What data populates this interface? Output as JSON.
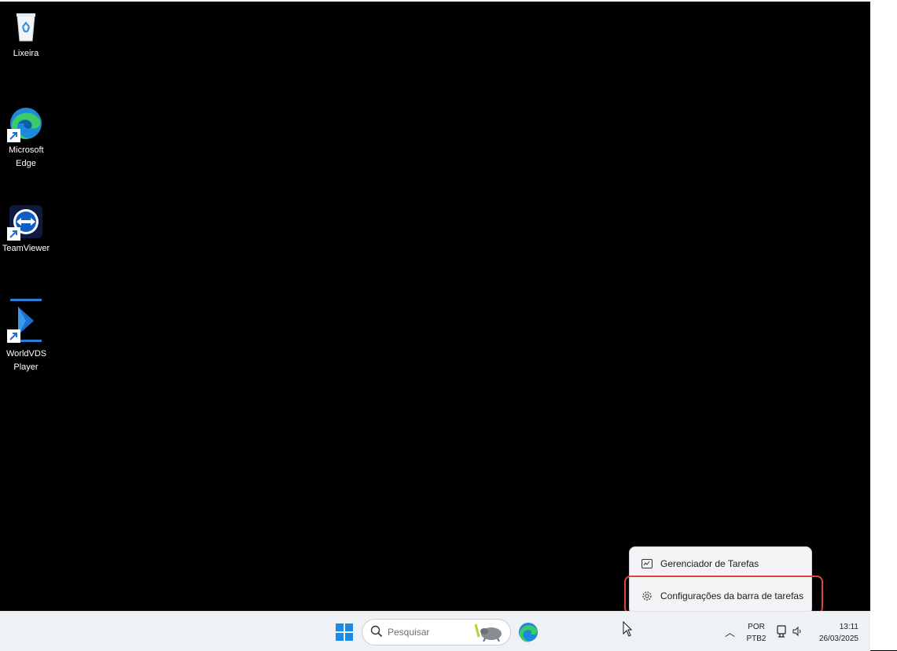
{
  "desktop": {
    "icons": [
      {
        "name": "recycle-bin",
        "label": "Lixeira"
      },
      {
        "name": "microsoft-edge",
        "label": "Microsoft Edge"
      },
      {
        "name": "teamviewer",
        "label": "TeamViewer"
      },
      {
        "name": "worldvds-player",
        "label": "WorldVDS Player"
      }
    ]
  },
  "taskbar": {
    "search_placeholder": "Pesquisar",
    "tray": {
      "lang_line1": "POR",
      "lang_line2": "PTB2",
      "time": "13:11",
      "date": "26/03/2025"
    }
  },
  "context_menu": {
    "items": [
      {
        "label": "Gerenciador de Tarefas",
        "icon": "task-manager-icon"
      },
      {
        "label": "Configurações da barra de tarefas",
        "icon": "gear-icon"
      }
    ],
    "highlight_color": "#d84a3c"
  },
  "colors": {
    "desktop_bg": "#000000",
    "taskbar_bg": "#eef1f6",
    "windows_blue": "#1a8ae6"
  }
}
